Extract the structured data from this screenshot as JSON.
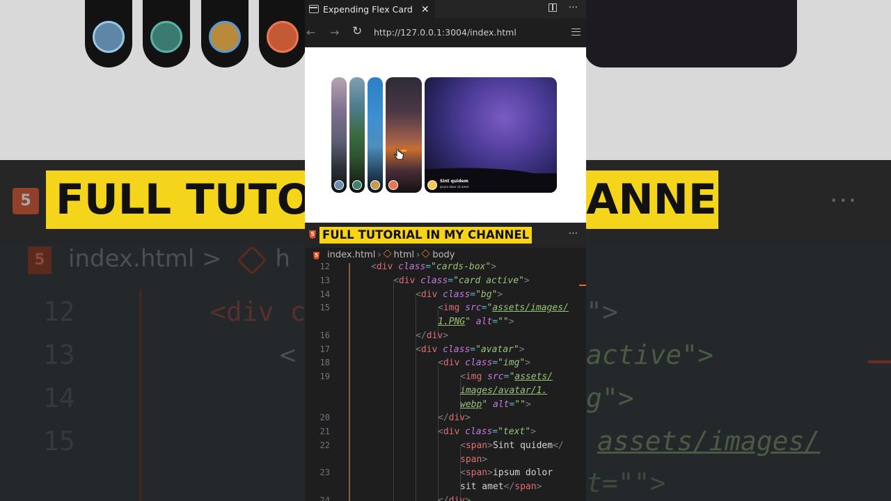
{
  "window": {
    "tab_title": "Expending Flex Card",
    "tab_close": "✕",
    "split_icon": "split-editor-icon",
    "more": "···"
  },
  "browser": {
    "url": "http://127.0.0.1:3004/index.html",
    "back": "←",
    "forward": "→",
    "reload": "↻"
  },
  "preview": {
    "active_card_title": "Sint quidem",
    "active_card_subtitle": "ipsum dolor sit amet",
    "avatar_colors": [
      "#9ac7e2",
      "#5bb3a7",
      "#e8b84a",
      "#e9774f",
      "#f2c94c"
    ]
  },
  "overlay": {
    "banner": "FULL TUTORIAL IN MY CHANNEL",
    "banner_color": "#f7d417",
    "more": "···"
  },
  "breadcrumb": {
    "file": "index.html",
    "el1": "html",
    "el2": "body"
  },
  "code": {
    "lines": [
      {
        "n": "12",
        "parts": [
          [
            "t-br",
            "<"
          ],
          [
            "t-tn",
            "div"
          ],
          [
            "t-at",
            " class"
          ],
          [
            "t-eq",
            "="
          ],
          [
            "t-st",
            "\"cards-box\""
          ],
          [
            "t-br",
            ">"
          ]
        ],
        "indent": 95
      },
      {
        "n": "13",
        "parts": [
          [
            "t-br",
            "<"
          ],
          [
            "t-tn",
            "div"
          ],
          [
            "t-at",
            " class"
          ],
          [
            "t-eq",
            "="
          ],
          [
            "t-st",
            "\"card active\""
          ],
          [
            "t-br",
            ">"
          ]
        ],
        "indent": 127
      },
      {
        "n": "14",
        "parts": [
          [
            "t-br",
            "<"
          ],
          [
            "t-tn",
            "div"
          ],
          [
            "t-at",
            " class"
          ],
          [
            "t-eq",
            "="
          ],
          [
            "t-st",
            "\"bg\""
          ],
          [
            "t-br",
            ">"
          ]
        ],
        "indent": 159
      },
      {
        "n": "15",
        "parts": [
          [
            "t-br",
            "<"
          ],
          [
            "t-tn",
            "img"
          ],
          [
            "t-at",
            " src"
          ],
          [
            "t-eq",
            "="
          ],
          [
            "t-st",
            "\""
          ],
          [
            "t-st u",
            "assets/images/"
          ]
        ],
        "indent": 191
      },
      {
        "n": "",
        "parts": [
          [
            "t-st u",
            "1.PNG"
          ],
          [
            "t-st",
            "\""
          ],
          [
            "t-at",
            " alt"
          ],
          [
            "t-eq",
            "="
          ],
          [
            "t-st",
            "\"\""
          ],
          [
            "t-br",
            ">"
          ]
        ],
        "indent": 191
      },
      {
        "n": "16",
        "parts": [
          [
            "t-br",
            "</"
          ],
          [
            "t-tn",
            "div"
          ],
          [
            "t-br",
            ">"
          ]
        ],
        "indent": 159
      },
      {
        "n": "17",
        "parts": [
          [
            "t-br",
            "<"
          ],
          [
            "t-tn",
            "div"
          ],
          [
            "t-at",
            " class"
          ],
          [
            "t-eq",
            "="
          ],
          [
            "t-st",
            "\"avatar\""
          ],
          [
            "t-br",
            ">"
          ]
        ],
        "indent": 159
      },
      {
        "n": "18",
        "parts": [
          [
            "t-br",
            "<"
          ],
          [
            "t-tn",
            "div"
          ],
          [
            "t-at",
            " class"
          ],
          [
            "t-eq",
            "="
          ],
          [
            "t-st",
            "\"img\""
          ],
          [
            "t-br",
            ">"
          ]
        ],
        "indent": 191
      },
      {
        "n": "19",
        "parts": [
          [
            "t-br",
            "<"
          ],
          [
            "t-tn",
            "img"
          ],
          [
            "t-at",
            " src"
          ],
          [
            "t-eq",
            "="
          ],
          [
            "t-st",
            "\""
          ],
          [
            "t-st u",
            "assets/"
          ]
        ],
        "indent": 223
      },
      {
        "n": "",
        "parts": [
          [
            "t-st u",
            "images/avatar/1."
          ]
        ],
        "indent": 223
      },
      {
        "n": "",
        "parts": [
          [
            "t-st u",
            "webp"
          ],
          [
            "t-st",
            "\""
          ],
          [
            "t-at",
            " alt"
          ],
          [
            "t-eq",
            "="
          ],
          [
            "t-st",
            "\"\""
          ],
          [
            "t-br",
            ">"
          ]
        ],
        "indent": 223
      },
      {
        "n": "20",
        "parts": [
          [
            "t-br",
            "</"
          ],
          [
            "t-tn",
            "div"
          ],
          [
            "t-br",
            ">"
          ]
        ],
        "indent": 191
      },
      {
        "n": "21",
        "parts": [
          [
            "t-br",
            "<"
          ],
          [
            "t-tn",
            "div"
          ],
          [
            "t-at",
            " class"
          ],
          [
            "t-eq",
            "="
          ],
          [
            "t-st",
            "\"text\""
          ],
          [
            "t-br",
            ">"
          ]
        ],
        "indent": 191
      },
      {
        "n": "22",
        "parts": [
          [
            "t-br",
            "<"
          ],
          [
            "t-tn",
            "span"
          ],
          [
            "t-br",
            ">"
          ],
          [
            "t-tx",
            "Sint quidem"
          ],
          [
            "t-br",
            "</"
          ]
        ],
        "indent": 223
      },
      {
        "n": "",
        "parts": [
          [
            "t-tn",
            "span"
          ],
          [
            "t-br",
            ">"
          ]
        ],
        "indent": 223
      },
      {
        "n": "23",
        "parts": [
          [
            "t-br",
            "<"
          ],
          [
            "t-tn",
            "span"
          ],
          [
            "t-br",
            ">"
          ],
          [
            "t-tx",
            "ipsum dolor"
          ]
        ],
        "indent": 223
      },
      {
        "n": "",
        "parts": [
          [
            "t-tx",
            "sit amet"
          ],
          [
            "t-br",
            "</"
          ],
          [
            "t-tn",
            "span"
          ],
          [
            "t-br",
            ">"
          ]
        ],
        "indent": 223
      },
      {
        "n": "24",
        "parts": [
          [
            "t-br",
            "</"
          ],
          [
            "t-tn",
            "div"
          ],
          [
            "t-br",
            ">"
          ]
        ],
        "indent": 191
      }
    ]
  },
  "background": {
    "banner_left": "FULL TUTOR",
    "banner_right": "ANNEL",
    "crumb_file": "index.html",
    "crumb_sep": ">",
    "crumb_next": "h",
    "line_numbers": [
      "12",
      "13",
      "14",
      "15"
    ],
    "code_line_12_left": "<div c",
    "code_line_12_right": "\">",
    "code_line_13_left": "<",
    "code_line_13_right": "active\">",
    "code_line_14_right": "g\">",
    "code_line_15_right": "assets/images/",
    "code_line_16_right": "t=\"\">"
  }
}
